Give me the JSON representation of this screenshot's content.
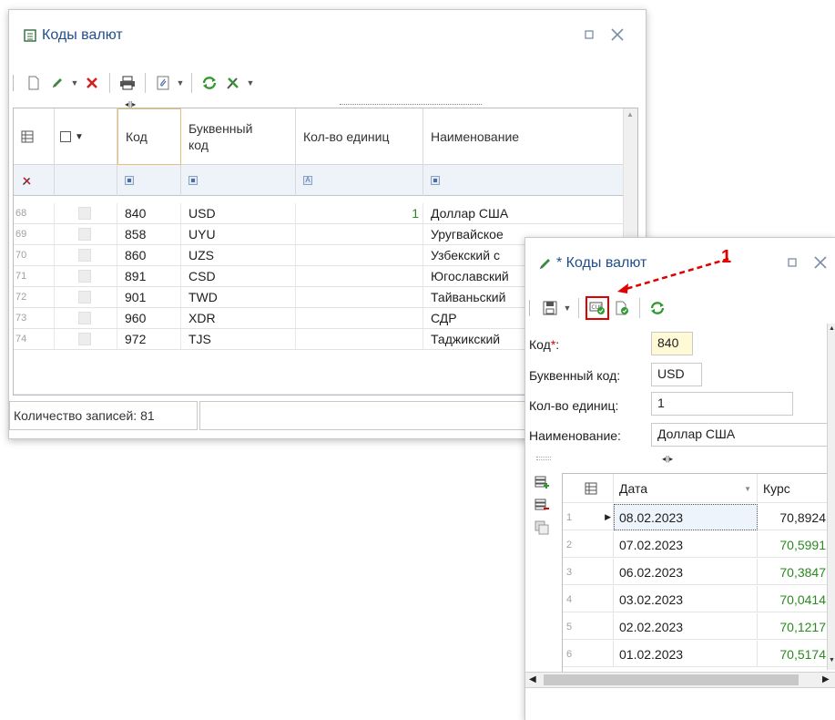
{
  "window_list": {
    "title": "Коды валют",
    "columns": {
      "code": "Код",
      "alpha_code": "Буквенный код",
      "units": "Кол-во единиц",
      "name": "Наименование"
    },
    "rows": [
      {
        "n": "68",
        "code": "840",
        "alpha": "USD",
        "units": "1",
        "name": "Доллар США"
      },
      {
        "n": "69",
        "code": "858",
        "alpha": "UYU",
        "units": "",
        "name": "Уругвайское"
      },
      {
        "n": "70",
        "code": "860",
        "alpha": "UZS",
        "units": "",
        "name": "Узбекский с"
      },
      {
        "n": "71",
        "code": "891",
        "alpha": "CSD",
        "units": "",
        "name": "Югославский"
      },
      {
        "n": "72",
        "code": "901",
        "alpha": "TWD",
        "units": "",
        "name": "Тайваньский"
      },
      {
        "n": "73",
        "code": "960",
        "alpha": "XDR",
        "units": "",
        "name": "СДР"
      },
      {
        "n": "74",
        "code": "972",
        "alpha": "TJS",
        "units": "",
        "name": "Таджикский"
      }
    ],
    "status": "Количество записей: 81"
  },
  "window_edit": {
    "title": "* Коды валют",
    "fields": {
      "code_label": "Код",
      "code_required": "*",
      "code_label_suffix": ":",
      "code_value": "840",
      "alpha_label": "Буквенный код:",
      "alpha_value": "USD",
      "units_label": "Кол-во единиц:",
      "units_value": "1",
      "name_label": "Наименование:",
      "name_value": "Доллар США"
    },
    "rates": {
      "col_date": "Дата",
      "col_rate": "Курс",
      "rows": [
        {
          "n": "1",
          "date": "08.02.2023",
          "rate": "70,8924"
        },
        {
          "n": "2",
          "date": "07.02.2023",
          "rate": "70,5991"
        },
        {
          "n": "3",
          "date": "06.02.2023",
          "rate": "70,3847"
        },
        {
          "n": "4",
          "date": "03.02.2023",
          "rate": "70,0414"
        },
        {
          "n": "5",
          "date": "02.02.2023",
          "rate": "70,1217"
        },
        {
          "n": "6",
          "date": "01.02.2023",
          "rate": "70,5174"
        }
      ]
    }
  },
  "annotation": {
    "label": "1"
  },
  "colors": {
    "accent_blue": "#1f4e8c",
    "rate_green": "#2a8a1e",
    "highlight_red": "#e00000",
    "units_green": "#2a8a1e"
  },
  "icons": [
    "new-document-icon",
    "edit-pencil-icon",
    "delete-x-icon",
    "print-icon",
    "attach-icon",
    "refresh-icon",
    "tools-icon",
    "save-icon",
    "currency-rates-icon",
    "approve-icon",
    "add-row-icon",
    "remove-row-icon",
    "copy-rows-icon",
    "grid-settings-icon"
  ]
}
